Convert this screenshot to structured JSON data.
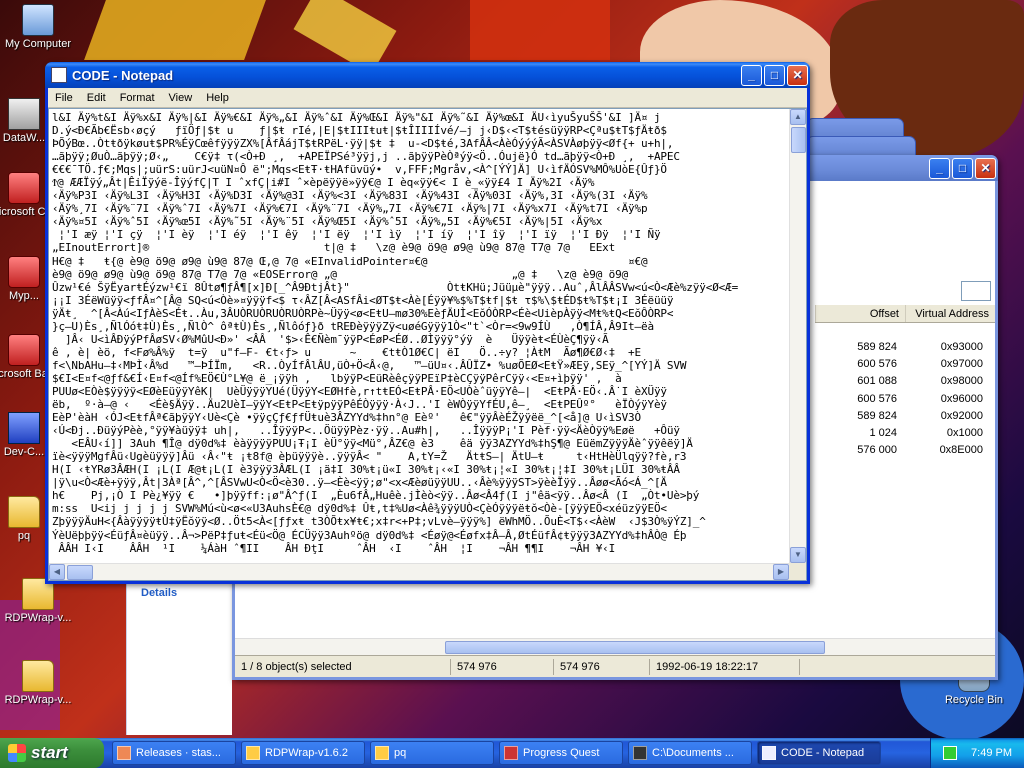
{
  "desktop": {
    "icons": [
      {
        "label": "My Computer"
      },
      {
        "label": "DataW..."
      },
      {
        "label": "Microsoft C++"
      },
      {
        "label": "Myp..."
      },
      {
        "label": "Microsoft Basic"
      },
      {
        "label": "Dev-C..."
      },
      {
        "label": "pq"
      },
      {
        "label": "RDPWrap-v..."
      },
      {
        "label": "RDPWrap-v..."
      },
      {
        "label": "Recycle Bin"
      }
    ]
  },
  "notepad": {
    "title": "CODE - Notepad",
    "menu": [
      "File",
      "Edit",
      "Format",
      "View",
      "Help"
    ],
    "lines": [
      "l&I Äÿ%t&I Äÿ%x&I Äÿ%|&I Äÿ%€&I Äÿ%„&I Äÿ%ˆ&I Äÿ%Œ&I Äÿ%\"&I Äÿ%˜&I Äÿ%œ&I ÄU‹ìyuŠyuŠŠ'&I ]Ä¤ j",
      "D.ý<Ð€Ãb€Ësb‹øçý   ƒïÖƒ|$ŧ u    ƒ|$ŧ rIé,|E|$ŧIIIŧuŧ|$ŧÎIIIÍvé/–j j‹D$‹<T$ŧésüÿÿRP<Çªu$ŧT$ƒÄŧð$",
      "ÞÕýBœ..Òtŧðÿkøuŧ$PR%ÉÿCœêfÿÿÿZX%[ÂfÂájT$ŧRPëL·ÿÿ|$ŧ ‡  u-<D$ŧé,3AfÂÂ<ÀèÓýýýÃ<ÀSVÀøþÿÿ<Øf{+ u+h|,",
      "…ãþÿÿ;ØuÒ…ãþÿÿ;Ø‹„    C€ÿ‡ τ(<Ò+Ð ¸,  +APEÏPSé³ÿÿj,j ..ãþÿÿPèÒªýÿ<Ö..Óujë}Ó td…ãþÿÿ<Ò+Ð ¸,  +APEC",
      "€€€¯TÖ.ƒ€;Mqs|;uürS:uürJ<uüN¤Ô ë\";Mqs<EŧŦ·ŧHAfüvüý•  v,FFF;Mgråv,<À^[ÝÝ]Ä] U‹ìfÄÓSV%MÔ%UòE{Ûƒ}Ö",
      "Ϯ@ ÆÆÏÿý„Ât|ÊiÏÿýë-ÎÿýfÇ|T I ˆxfÇ|i#I ˆ×èpëÿÿë»ÿÿ€@ I èq«ÿÿ€< I è_«ÿÿ£4 I Äÿ%2I ‹Äÿ%",
      "‹Äÿ%P3I ‹Äÿ%L3I ‹Äÿ%H3I ‹Äÿ%D3I ‹Äÿ%@3I ‹Äÿ%<3I ‹Äÿ%83I ‹Äÿ%43I ‹Äÿ%03I ‹Äÿ%,3I ‹Äÿ%(3I ‹Äÿ%",
      "‹Äÿ%¸7I ‹Äÿ%¨7I ‹Äÿ%ˆ7I ‹Äÿ%7I ‹Äÿ%€7I ‹Äÿ%¨7I ‹Äÿ%„7I ‹Äÿ%€7I ‹Äÿ%|7I ‹Äÿ%x7I ‹Äÿ%t7I ‹Äÿ%p",
      "‹Äÿ%¤5I ‹Äÿ%ˆ5I ‹Äÿ%œ5I ‹Äÿ%˜5I ‹Äÿ%¨5I ‹Äÿ%Œ5I ‹Äÿ%ˆ5I ‹Äÿ%„5I ‹Äÿ%€5I ‹Äÿ%|5I ‹Äÿ%x",
      " ¦'I æÿ ¦'I çÿ  ¦'I èÿ  ¦'I éÿ  ¦'I êÿ  ¦'I ëÿ  ¦'I ìÿ  ¦'I íÿ  ¦'I îÿ  ¦'I ïÿ  ¦'I Ðÿ  ¦'I Ñÿ",
      "„EInoutErrort]®                           t|@ ‡   \\z@ è9@ ö9@ ø9@ ù9@ 87@ T7@ 7@   EExt",
      "H€@ ‡   ŧ{@ è9@ ö9@ ø9@ ù9@ 87@ Œ‚@ 7@ «EInvalidPointer¤€@                               ¤€@",
      "è9@ ö9@ ø9@ ù9@ ö9@ 87@ T7@ 7@ «EOSError@ „@                           „@ ‡   \\z@ è9@ ö9@",
      "Ûzw¹€é ŠÿËyarŧÉýzw¹€ï 8Ûtø¶ƒÂ¶[x]Ð[_^Â9ÐtjÂt}\"               ÒtŧKHü;Jüüμè\"ÿÿÿ..Auˆ,ÂlÂÂSVw<ú<Ò<Æè%zÿÿ<Ø<Æ=",
      "¡¡I 3ÉëWüÿÿ<ƒfÂ¤^[Â@ SQ<ú<Òè»¤ÿÿÿf<$ τ‹ÂZ[Â<ASfÂi<ØT$ŧ<Àè[Éÿÿ¥%$%T$ŧf|$ŧ τ$%\\$ŧÉD$ŧ%T$ŧ¡I 3Éëüüÿ",
      "ÿÄŧ¸  ^[Â<Àú<IƒÀèS<Éŧ..Àu,3ÂUÒRUÒRUÒRUÒRPè~Üÿÿ<ø<EŧU–mø30%EèƒÄUÌ<EŏÓÒRP<Éè<UièpÀÿÿ<Mŧ%ŧQ<EŏÔÒRP<",
      "}ç–U)Ès¸‚ÑlÓóŧ‡Ù)Ès¸‚ÑlÒ^ ôªŧÙ)Ès¸‚Ñlôóƒ}ð tREÐèÿÿÿZÿ<uøéGÿÿÿ1Ò<\"t`<Òr=<9w9ÍÙ   ,Ò¶ÍÂ‚Â9It–ëà",
      "  ]Â‹ U<ìÂÐÿýPfÂøSV‹Ø%MûU<Ð»' <ÂÂ  '$>‹Ê€Ñèm¯ÿÿP<ÉøP<ÉØ..ØÌÿÿÿ°ýÿ  è   Üÿÿèŧ<ÉÙèÇ¶ÿÿ‹Ã",
      "ê , è| èö, f<Fø%Â%ÿ  t=ÿ  u\"f–F- €t‹ƒ> u      ~    €tŧÒ1Ø€C| ëI   Ö..÷y? ¦ÀŧM  Ãø¶Ø€Ø‹‡  +E",
      "f<\\NbAHu–‡‹MÞÌ‹Â%d   ™–ÞÍÏm,   <R..ÒyÍfÂlÂU,üÒ+Ö<Â‹@,   ™–üU¤‹.ÂÛÏZ• %uøÕEØ<EŧŸ»ÆEÿ,SEÿ_^[YÝ]Ä SVW",
      "$€I<E¤f<@ƒf&€Í‹E¤f<@Íf%EÖ€Ù°L¥@ ë_¡ÿÿh ,   lbÿÿP<EüRèêçÿÿPEïP‡èCÇÿÿPêrCÿÿ‹<E¤+ìþÿÿ' ,  à",
      "PUUø<EÒè$ÿÿÿÿ<EØèEüÿÿYêK|  UèÜÿÿÿYUé(ÜÿÿY<EØHfè,r↑tŧEÓ<EŧPÂ·EÖ<UÒèˆüÿÿYê–|  <EŧPÂ·EÖ‹.Â˙I èXÜÿÿ",
      "ëb,  º·à–@ ‹   <Éè§Äÿÿ..Äu2UèI–ÿÿY<EŧP<EŧÿpÿÿPêÉÒÿÿÿ·À‹J..'I èWÒÿÿYfÉU,ê–¸  <EŧPEÛº°   èÏÒýÿYèÿ",
      "EèP'èàH ‹ÓJ<EŧfÂª€ãþÿÿY‹Uè<Çè •ÿÿçÇƒ€ƒfÜŧuè3ÂZYYd%‡hn°@ Eèº'   ê€\"ÿÿÂèÉŽÿÿëë_^[<å]@ U‹ìSV3Ò",
      "‹Ú<Ðj..ÐüÿýPèè,°ÿÿ¥àüÿÿ‡ uh|,   ..ÎÿÿÿP<..ÖüÿÿPèz·ÿÿ..Au#h|,   ..ÎÿÿÿP¡'I Pèf·ÿÿ<ÄèÒÿÿ%Eøë   +Ôüÿ",
      "   <EÂU‹í]] 3Auh ¶Î@ dÿ0d%‡ èàÿÿÿÿPUU¡Ŧ¡I èÜ°ÿÿ<Mü°,ÂZ€@ è3    êä ÿÿ3AZYYd%‡hŞ¶@ EüëmZÿÿÿÄèˆÿÿêëÿ]Ä",
      "ïè<ÿÿÿMgfÂü‹Ugèüÿÿÿ]Âü ‹Â‹\"ŧ ¡ŧ8f@ èþüÿÿÿè..ÿÿÿÂ< \"    A,tY=Ž   ÄtŧS–| ÄtU–ŧ     t‹HtHèÜlqÿÿ?fè,r3",
      "H(I ‹ŧYRø3ÂÆH(I ¡L(I Æ@ŧ¡L(I è3ÿÿÿ3ÂÆL(I ¡ä‡I 30%ŧ¡ü«I 30%ŧ¡‹«I 30%ŧ¡¦«I 30%ŧ¡¦‡I 30%ŧ¡LÜI 30%ŧÂÂ",
      "|ÿ\\u<Ò<Æè+ÿÿÿ,Ât|3Àª[Â^,^[ÂSVwU<Ò<Ö<è30..ÿ–<Èè<ÿÿ;ø\"<x<ÆèøüÿÿUU..‹Âè%ÿÿÿST>ÿèèÏÿÿ..Âøø<Ãó<Á_^[Ä",
      "h€    Pj,¡Ò I Pè¿¥ÿÿ €   •]þÿÿff:¡ø\"Â^ƒ(I  „Èu6fÂ„Huêè.jÌèò<ÿÿ..Âø<Â4ƒ(I j\"êä<ÿÿ..Âø<Â (I  „Òt•Uè>þý",
      "m:ss  U<ij j j j j SVW%Mú<ù<ø<«U3AuhsÈ€@ dÿ0d%‡ Ûŧ,t‡%Uø<Àê¾ÿÿÿUÒ<ÇèÓÿÿÿëŧŏ<Òè-[ÿÿÿEÖ<xéüzÿÿEÖ<",
      "ZþÿÿÿÄuH<{ÂàÿÿÿÿŧÙ‡ÿËŏÿÿ<Ø..Öt5<À<[ƒƒxŧ t3ÒÕŧx¥ŧ€;x‡r<+P‡;vLvè–ÿÿÿ%] ëWhMÖ..ÕuÈ<T$‹<ÀèW  ‹J$3Ò%ÿÝZ]_^",
      "ÝèUëþþÿÿ<ÉüƒÂ¤èüÿÿ..Â¬>PëP‡ƒuŧ<Éü<Ö@ ÉCÜÿÿ3Auhºö@ dÿ0d%‡ <Éøÿ@<Éøfx‡Â—Â‚ØtÉüfÂ¢ŧÿÿÿ3AZYYd%‡hÂÒ@ Éþ",
      " ÂÂH I‹I    ÂÂH  ¹I    ¼ÁàH ˆ¶II    ÂH ÐţI     ˆÂH  ‹I    ˆÂH  ¦I    ¬ÂH ¶¶I    ¬ÂH ¥‹I"
    ]
  },
  "explorer": {
    "columns": [
      "Offset",
      "Virtual Address"
    ],
    "rows": [
      {
        "offset": "589 824",
        "va": "0x93000"
      },
      {
        "offset": "600 576",
        "va": "0x97000"
      },
      {
        "offset": "601 088",
        "va": "0x98000"
      },
      {
        "offset": "600 576",
        "va": "0x96000"
      },
      {
        "offset": "589 824",
        "va": "0x92000"
      },
      {
        "offset": "1 024",
        "va": "0x1000"
      },
      {
        "offset": "576 000",
        "va": "0x8E000"
      }
    ],
    "details_label": "Details",
    "status": {
      "selected": "1 / 8 object(s) selected",
      "size1": "574 976",
      "size2": "574 976",
      "date": "1992-06-19 18:22:17"
    }
  },
  "taskbar": {
    "start_label": "start",
    "tasks": [
      {
        "label": "Releases · stas...",
        "active": false
      },
      {
        "label": "RDPWrap-v1.6.2",
        "active": false
      },
      {
        "label": "pq",
        "active": false
      },
      {
        "label": "Progress Quest",
        "active": false
      },
      {
        "label": "C:\\Documents ...",
        "active": false
      },
      {
        "label": "CODE - Notepad",
        "active": true
      }
    ],
    "clock": "7:49 PM"
  }
}
